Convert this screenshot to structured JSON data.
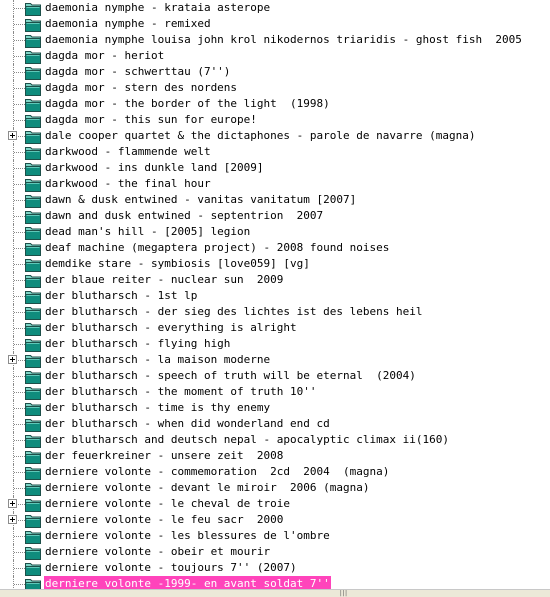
{
  "tree": {
    "items": [
      {
        "label": "daemonia nymphe - krataia asterope",
        "expandable": false
      },
      {
        "label": "daemonia nymphe - remixed",
        "expandable": false
      },
      {
        "label": "daemonia nymphe louisa john krol nikodernos triaridis - ghost fish  2005",
        "expandable": false
      },
      {
        "label": "dagda mor - heriot",
        "expandable": false
      },
      {
        "label": "dagda mor - schwerttau (7'')",
        "expandable": false
      },
      {
        "label": "dagda mor - stern des nordens",
        "expandable": false
      },
      {
        "label": "dagda mor - the border of the light  (1998)",
        "expandable": false
      },
      {
        "label": "dagda mor - this sun for europe!",
        "expandable": false
      },
      {
        "label": "dale cooper quartet & the dictaphones - parole de navarre (magna)",
        "expandable": true
      },
      {
        "label": "darkwood - flammende welt",
        "expandable": false
      },
      {
        "label": "darkwood - ins dunkle land [2009]",
        "expandable": false
      },
      {
        "label": "darkwood - the final hour",
        "expandable": false
      },
      {
        "label": "dawn & dusk entwined - vanitas vanitatum [2007]",
        "expandable": false
      },
      {
        "label": "dawn and dusk entwined - septentrion  2007",
        "expandable": false
      },
      {
        "label": "dead man's hill - [2005] legion",
        "expandable": false
      },
      {
        "label": "deaf machine (megaptera project) - 2008 found noises",
        "expandable": false
      },
      {
        "label": "demdike stare - symbiosis [love059] [vg]",
        "expandable": false
      },
      {
        "label": "der blaue reiter - nuclear sun  2009",
        "expandable": false
      },
      {
        "label": "der blutharsch - 1st lp",
        "expandable": false
      },
      {
        "label": "der blutharsch - der sieg des lichtes ist des lebens heil",
        "expandable": false
      },
      {
        "label": "der blutharsch - everything is alright",
        "expandable": false
      },
      {
        "label": "der blutharsch - flying high",
        "expandable": false
      },
      {
        "label": "der blutharsch - la maison moderne",
        "expandable": true
      },
      {
        "label": "der blutharsch - speech of truth will be eternal  (2004)",
        "expandable": false
      },
      {
        "label": "der blutharsch - the moment of truth 10''",
        "expandable": false
      },
      {
        "label": "der blutharsch - time is thy enemy",
        "expandable": false
      },
      {
        "label": "der blutharsch - when did wonderland end cd",
        "expandable": false
      },
      {
        "label": "der blutharsch and deutsch nepal - apocalyptic climax ii(160)",
        "expandable": false
      },
      {
        "label": "der feuerkreiner - unsere zeit  2008",
        "expandable": false
      },
      {
        "label": "derniere volonte - commemoration  2cd  2004  (magna)",
        "expandable": false
      },
      {
        "label": "derniere volonte - devant le miroir  2006 (magna)",
        "expandable": false
      },
      {
        "label": "derniere volonte - le cheval de troie",
        "expandable": true
      },
      {
        "label": "derniere volonte - le feu sacr  2000",
        "expandable": true
      },
      {
        "label": "derniere volonte - les blessures de l'ombre",
        "expandable": false
      },
      {
        "label": "derniere volonte - obeir et mourir",
        "expandable": false
      },
      {
        "label": "derniere volonte - toujours 7'' (2007)",
        "expandable": false
      },
      {
        "label": "derniere volonte -1999- en avant soldat 7''",
        "expandable": false,
        "selected": true
      }
    ]
  },
  "status": {
    "grip": "|||"
  },
  "colors": {
    "selection": "#ff44bb",
    "folder_body": "#0f8c7d",
    "folder_tab": "#7fd6c8",
    "tree_lines": "#8a8a8a"
  },
  "icons": {
    "folder": "folder-icon",
    "expand": "plus-expander-icon"
  }
}
